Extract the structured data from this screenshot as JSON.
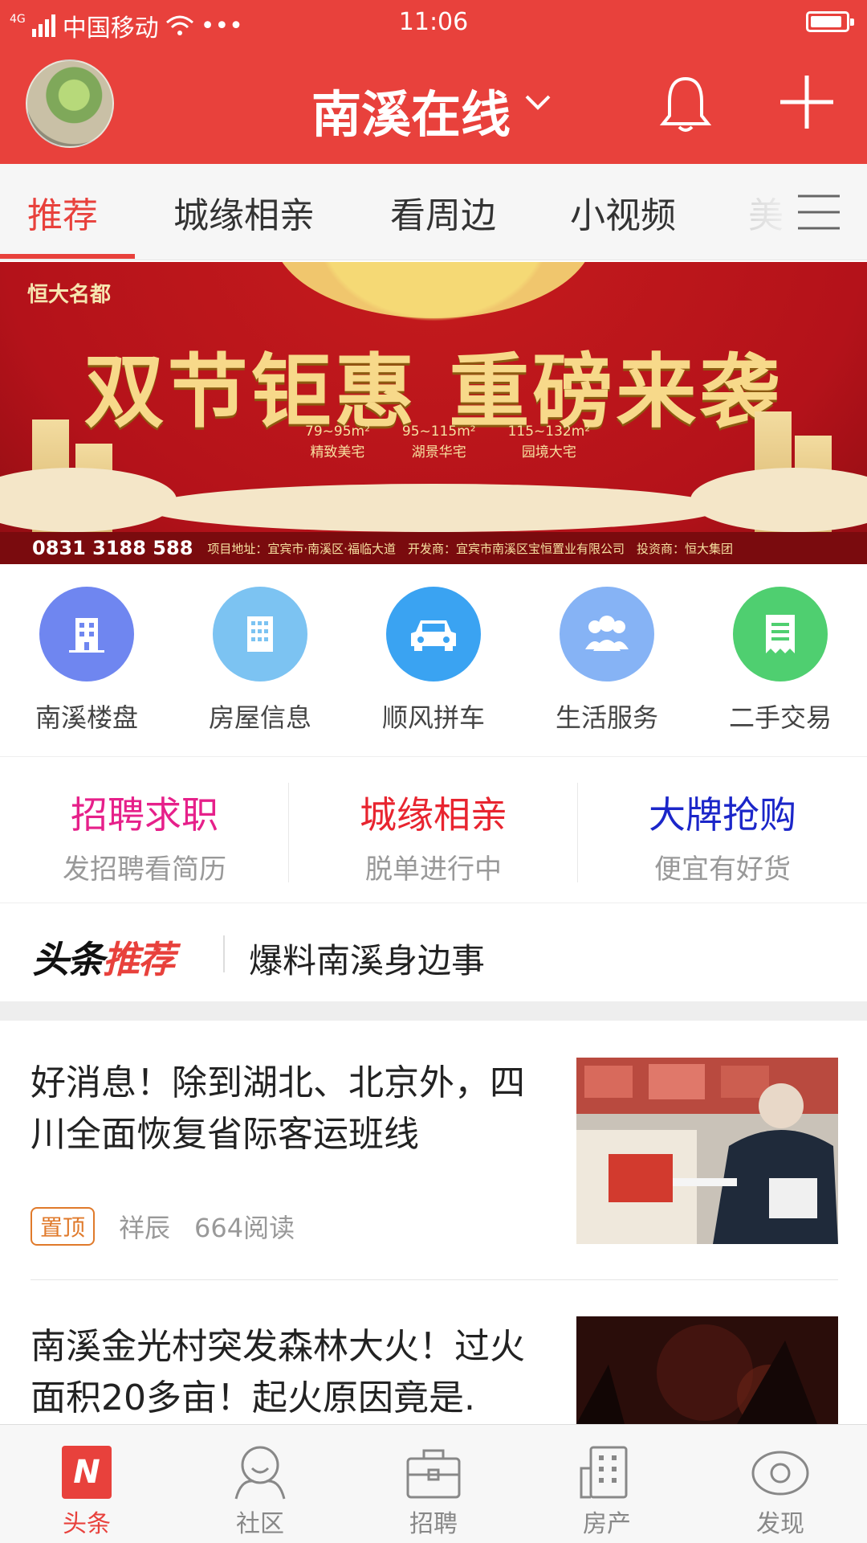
{
  "status_bar": {
    "network": "4G",
    "carrier": "中国移动",
    "dots": "•••",
    "time": "11:06"
  },
  "header": {
    "title": "南溪在线",
    "avatar_icon": "avatar-image",
    "icons": [
      "chevron-down-icon",
      "bell-icon",
      "plus-icon"
    ]
  },
  "tabs": {
    "items": [
      "推荐",
      "城缘相亲",
      "看周边",
      "小视频",
      "美"
    ],
    "active": "推荐"
  },
  "banner": {
    "brand": "恒大名都",
    "headline": "双节钜惠 重磅来袭",
    "specs": [
      {
        "size": "79~95m²",
        "label": "精致美宅"
      },
      {
        "size": "95~115m²",
        "label": "湖景华宅"
      },
      {
        "size": "115~132m²",
        "label": "园境大宅"
      }
    ],
    "phone": "0831 3188 588",
    "footer_text": "项目地址：宜宾市·南溪区·福临大道　开发商：宜宾市南溪区宝恒置业有限公司　投资商：恒大集团"
  },
  "quick_links": [
    {
      "label": "南溪楼盘",
      "icon": "building-icon",
      "color": "#6f86f0"
    },
    {
      "label": "房屋信息",
      "icon": "office-building-icon",
      "color": "#7cc3f2"
    },
    {
      "label": "顺风拼车",
      "icon": "car-icon",
      "color": "#3aa3f2"
    },
    {
      "label": "生活服务",
      "icon": "people-icon",
      "color": "#86b3f5"
    },
    {
      "label": "二手交易",
      "icon": "receipt-icon",
      "color": "#4fcf70"
    }
  ],
  "promos": [
    {
      "title": "招聘求职",
      "subtitle": "发招聘看简历",
      "color": "#e6208a"
    },
    {
      "title": "城缘相亲",
      "subtitle": "脱单进行中",
      "color": "#e8242f"
    },
    {
      "title": "大牌抢购",
      "subtitle": "便宜有好货",
      "color": "#1b26c9"
    }
  ],
  "headline_bar": {
    "logo_part1": "头条",
    "logo_part2": "推荐",
    "text": "爆料南溪身边事"
  },
  "news": [
    {
      "title": "好消息！除到湖北、北京外，四川全面恢复省际客运班线",
      "pin": "置顶",
      "author": "祥辰",
      "reads": "664阅读"
    },
    {
      "title": "南溪金光村突发森林大火！过火面积20多亩！起火原因竟是.",
      "pin": "",
      "author": "",
      "reads": ""
    }
  ],
  "tabbar": [
    {
      "label": "头条",
      "icon": "headline-n-icon",
      "active": true
    },
    {
      "label": "社区",
      "icon": "community-icon",
      "active": false
    },
    {
      "label": "招聘",
      "icon": "briefcase-icon",
      "active": false
    },
    {
      "label": "房产",
      "icon": "building-grid-icon",
      "active": false
    },
    {
      "label": "发现",
      "icon": "eye-icon",
      "active": false
    }
  ],
  "colors": {
    "brand_red": "#e8413c",
    "text_gray": "#999999",
    "pin_orange": "#e07a2b"
  }
}
